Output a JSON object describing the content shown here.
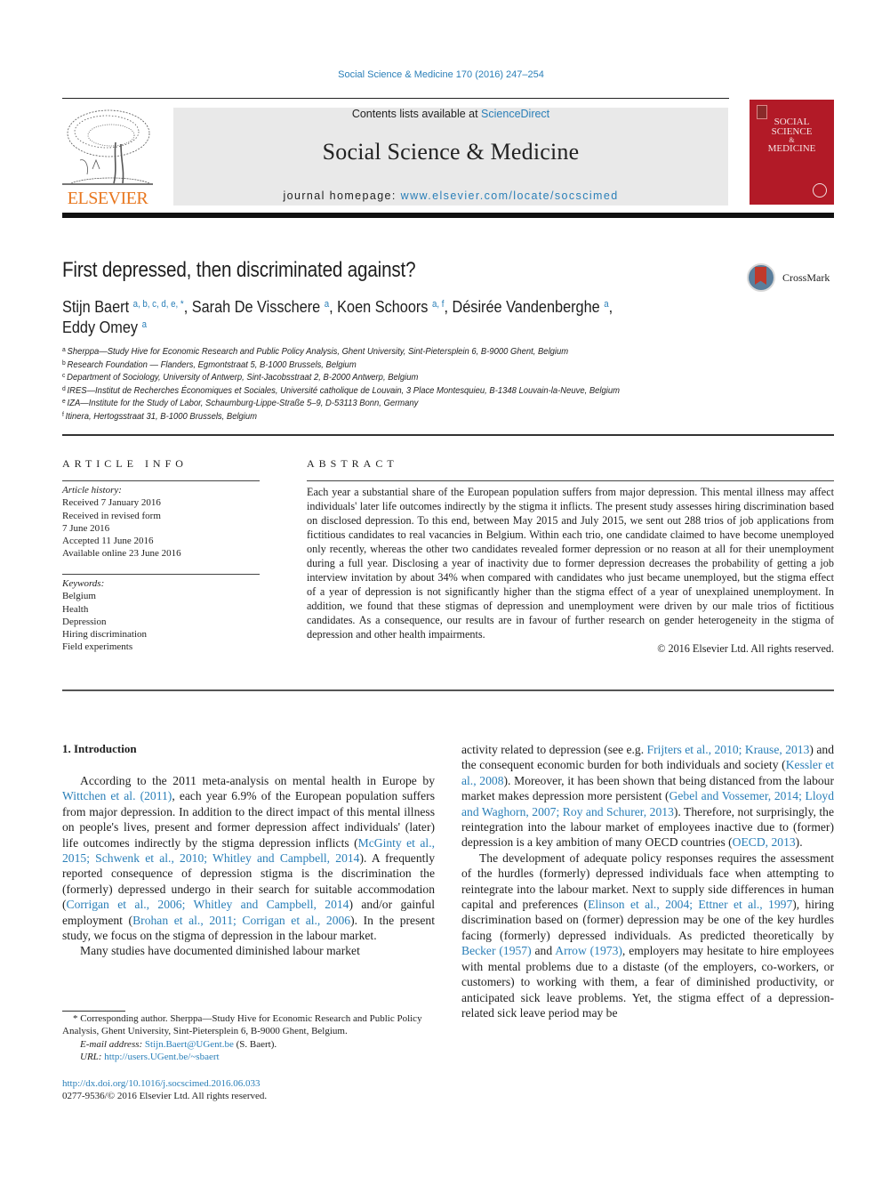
{
  "header": {
    "citation": "Social Science & Medicine 170 (2016) 247–254",
    "contents_prefix": "Contents lists available at ",
    "contents_link": "ScienceDirect",
    "journal_title": "Social Science & Medicine",
    "homepage_prefix": "journal homepage: ",
    "homepage_link": "www.elsevier.com/locate/socscimed",
    "publisher_logo_text": "ELSEVIER",
    "cover_title_lines": [
      "SOCIAL",
      "SCIENCE",
      "&",
      "MEDICINE"
    ],
    "colors": {
      "link": "#2a7fb8",
      "elsevier_orange": "#e8771f",
      "cover_red": "#b21a27",
      "banner_gray": "#e9e9e9"
    }
  },
  "article": {
    "title": "First depressed, then discriminated against?",
    "crossmark_label": "CrossMark",
    "authors": [
      {
        "name": "Stijn Baert",
        "sup": "a, b, c, d, e, *",
        "sep": ", "
      },
      {
        "name": "Sarah De Visschere",
        "sup": "a",
        "sep": ", "
      },
      {
        "name": "Koen Schoors",
        "sup": "a, f",
        "sep": ", "
      },
      {
        "name": "Désirée Vandenberghe",
        "sup": "a",
        "sep": ","
      },
      {
        "name": "Eddy Omey",
        "sup": "a",
        "sep": ""
      }
    ],
    "affiliations": [
      {
        "key": "a",
        "text": "Sherppa—Study Hive for Economic Research and Public Policy Analysis, Ghent University, Sint-Pietersplein 6, B-9000 Ghent, Belgium"
      },
      {
        "key": "b",
        "text": "Research Foundation — Flanders, Egmontstraat 5, B-1000 Brussels, Belgium"
      },
      {
        "key": "c",
        "text": "Department of Sociology, University of Antwerp, Sint-Jacobsstraat 2, B-2000 Antwerp, Belgium"
      },
      {
        "key": "d",
        "text": "IRES—Institut de Recherches Économiques et Sociales, Université catholique de Louvain, 3 Place Montesquieu, B-1348 Louvain-la-Neuve, Belgium"
      },
      {
        "key": "e",
        "text": "IZA—Institute for the Study of Labor, Schaumburg-Lippe-Straße 5–9, D-53113 Bonn, Germany"
      },
      {
        "key": "f",
        "text": "Itinera, Hertogsstraat 31, B-1000 Brussels, Belgium"
      }
    ]
  },
  "article_info": {
    "heading": "ARTICLE INFO",
    "history_label": "Article history:",
    "history": [
      "Received 7 January 2016",
      "Received in revised form",
      "7 June 2016",
      "Accepted 11 June 2016",
      "Available online 23 June 2016"
    ],
    "keywords_label": "Keywords:",
    "keywords": [
      "Belgium",
      "Health",
      "Depression",
      "Hiring discrimination",
      "Field experiments"
    ]
  },
  "abstract": {
    "heading": "ABSTRACT",
    "text": "Each year a substantial share of the European population suffers from major depression. This mental illness may affect individuals' later life outcomes indirectly by the stigma it inflicts. The present study assesses hiring discrimination based on disclosed depression. To this end, between May 2015 and July 2015, we sent out 288 trios of job applications from fictitious candidates to real vacancies in Belgium. Within each trio, one candidate claimed to have become unemployed only recently, whereas the other two candidates revealed former depression or no reason at all for their unemployment during a full year. Disclosing a year of inactivity due to former depression decreases the probability of getting a job interview invitation by about 34% when compared with candidates who just became unemployed, but the stigma effect of a year of depression is not significantly higher than the stigma effect of a year of unexplained unemployment. In addition, we found that these stigmas of depression and unemployment were driven by our male trios of fictitious candidates. As a consequence, our results are in favour of further research on gender heterogeneity in the stigma of depression and other health impairments.",
    "copyright": "© 2016 Elsevier Ltd. All rights reserved."
  },
  "body": {
    "section_heading": "1.  Introduction",
    "left_paragraphs": [
      [
        {
          "t": "According to the 2011 meta-analysis on mental health in Europe by "
        },
        {
          "t": "Wittchen et al. (2011)",
          "link": true
        },
        {
          "t": ", each year 6.9% of the European population suffers from major depression. In addition to the direct impact of this mental illness on people's lives, present and former depression affect individuals' (later) life outcomes indirectly by the stigma depression inflicts ("
        },
        {
          "t": "McGinty et al., 2015; Schwenk et al., 2010; Whitley and Campbell, 2014",
          "link": true
        },
        {
          "t": "). A frequently reported consequence of depression stigma is the discrimination the (formerly) depressed undergo in their search for suitable accommodation ("
        },
        {
          "t": "Corrigan et al., 2006; Whitley and Campbell, 2014",
          "link": true
        },
        {
          "t": ") and/or gainful employment ("
        },
        {
          "t": "Brohan et al., 2011; Corrigan et al., 2006",
          "link": true
        },
        {
          "t": "). In the present study, we focus on the stigma of depression in the labour market."
        }
      ],
      [
        {
          "t": "Many studies have documented diminished labour market"
        }
      ]
    ],
    "right_paragraphs": [
      [
        {
          "t": "activity related to depression (see e.g. "
        },
        {
          "t": "Frijters et al., 2010; Krause, 2013",
          "link": true
        },
        {
          "t": ") and the consequent economic burden for both individuals and society ("
        },
        {
          "t": "Kessler et al., 2008",
          "link": true
        },
        {
          "t": "). Moreover, it has been shown that being distanced from the labour market makes depression more persistent ("
        },
        {
          "t": "Gebel and Vossemer, 2014; Lloyd and Waghorn, 2007; Roy and Schurer, 2013",
          "link": true
        },
        {
          "t": "). Therefore, not surprisingly, the reintegration into the labour market of employees inactive due to (former) depression is a key ambition of many OECD countries ("
        },
        {
          "t": "OECD, 2013",
          "link": true
        },
        {
          "t": ")."
        }
      ],
      [
        {
          "t": "The development of adequate policy responses requires the assessment of the hurdles (formerly) depressed individuals face when attempting to reintegrate into the labour market. Next to supply side differences in human capital and preferences ("
        },
        {
          "t": "Elinson et al., 2004; Ettner et al., 1997",
          "link": true
        },
        {
          "t": "), hiring discrimination based on (former) depression may be one of the key hurdles facing (formerly) depressed individuals. As predicted theoretically by "
        },
        {
          "t": "Becker (1957)",
          "link": true
        },
        {
          "t": " and "
        },
        {
          "t": "Arrow (1973)",
          "link": true
        },
        {
          "t": ", employers may hesitate to hire employees with mental problems due to a distaste (of the employers, co-workers, or customers) to working with them, a fear of diminished productivity, or anticipated sick leave problems. Yet, the stigma effect of a depression-related sick leave period may be"
        }
      ]
    ]
  },
  "footnote": {
    "corresponding": "* Corresponding author. Sherppa—Study Hive for Economic Research and Public Policy Analysis, Ghent University, Sint-Pietersplein 6, B-9000 Ghent, Belgium.",
    "email_label": "E-mail address:",
    "email": "Stijn.Baert@UGent.be",
    "email_suffix": " (S. Baert).",
    "url_label": "URL:",
    "url": "http://users.UGent.be/~sbaert",
    "doi": "http://dx.doi.org/10.1016/j.socscimed.2016.06.033",
    "issn_copyright": "0277-9536/© 2016 Elsevier Ltd. All rights reserved."
  }
}
